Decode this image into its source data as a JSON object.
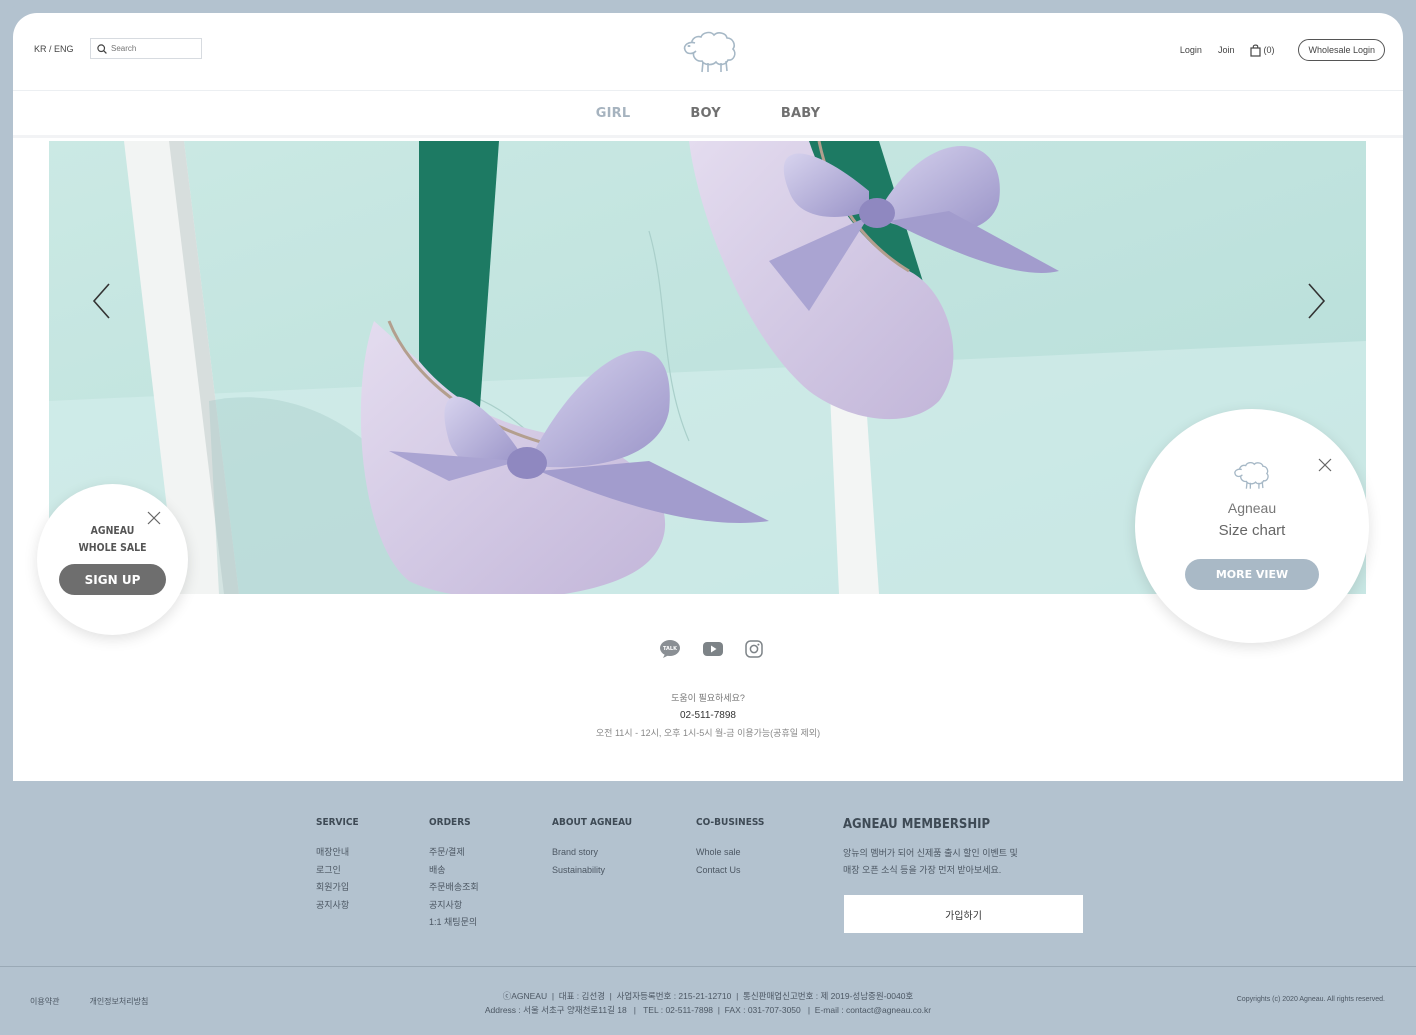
{
  "header": {
    "lang": "KR / ENG",
    "search_placeholder": "Search",
    "login": "Login",
    "join": "Join",
    "cart_count": "(0)",
    "wholesale_login": "Wholesale Login"
  },
  "nav": {
    "items": [
      {
        "label": "GIRL",
        "active": true
      },
      {
        "label": "BOY",
        "active": false
      },
      {
        "label": "BABY",
        "active": false
      }
    ]
  },
  "popup_left": {
    "line1": "AGNEAU",
    "line2": "WHOLE SALE",
    "button": "SIGN UP"
  },
  "popup_right": {
    "line1": "Agneau",
    "line2": "Size chart",
    "button": "MORE VIEW"
  },
  "social": {
    "talk_label": "TALK"
  },
  "help": {
    "question": "도움이 필요하세요?",
    "phone": "02-511-7898",
    "hours": "오전 11시 - 12시, 오후 1시-5시 월-금 이용가능(공휴일 제외)"
  },
  "footer": {
    "columns": [
      {
        "title": "SERVICE",
        "links": [
          "매장안내",
          "로그인",
          "회원가입",
          "공지사항"
        ]
      },
      {
        "title": "ORDERS",
        "links": [
          "주문/결제",
          "배송",
          "주문배송조회",
          "공지사항",
          "1:1 채팅문의"
        ]
      },
      {
        "title": "ABOUT AGNEAU",
        "links": [
          "Brand story",
          "Sustainability"
        ]
      },
      {
        "title": "CO-BUSINESS",
        "links": [
          "Whole sale",
          "Contact Us"
        ]
      }
    ],
    "membership": {
      "title": "AGNEAU MEMBERSHIP",
      "desc1": "앙뉴의 멤버가 되어 신제품 출시 할인 이벤트 및",
      "desc2": "매장 오픈 소식 등을 가장 먼저 받아보세요.",
      "button": "가입하기"
    },
    "terms": "이용약관",
    "privacy": "개인정보처리방침",
    "company_line1": "ⓒAGNEAU  |  대표 : 김선경  |  사업자등록번호 : 215-21-12710  |  통신판매업신고번호 : 제 2019-성남중원-0040호",
    "company_line2": "Address : 서울 서초구 양재천로11길 18   |   TEL : 02-511-7898  |  FAX : 031-707-3050   |  E-mail : contact@agneau.co.kr",
    "copyright": "Copyrights (c) 2020 Agneau. All rights reserved."
  }
}
